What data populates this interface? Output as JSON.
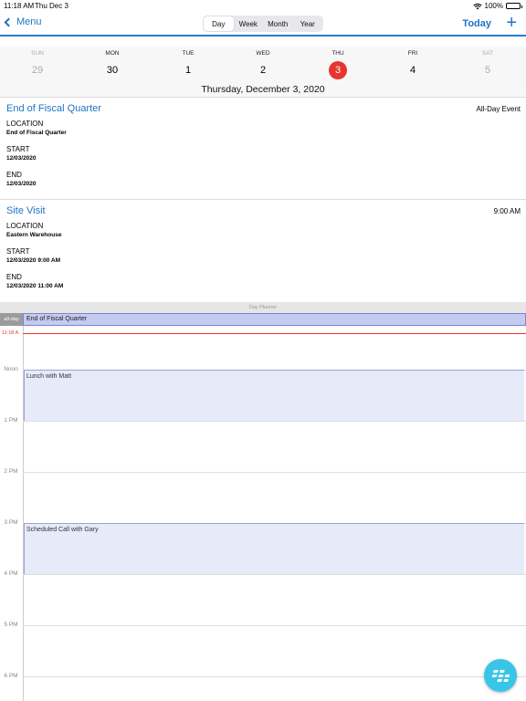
{
  "status": {
    "time": "11:18 AM",
    "date": "Thu Dec 3",
    "battery": "100%"
  },
  "nav": {
    "back_label": "Menu",
    "segments": [
      "Day",
      "Week",
      "Month",
      "Year"
    ],
    "today_label": "Today",
    "add_symbol": "+"
  },
  "week": {
    "days": [
      {
        "name": "SUN",
        "num": "29"
      },
      {
        "name": "MON",
        "num": "30"
      },
      {
        "name": "TUE",
        "num": "1"
      },
      {
        "name": "WED",
        "num": "2"
      },
      {
        "name": "THU",
        "num": "3"
      },
      {
        "name": "FRI",
        "num": "4"
      },
      {
        "name": "SAT",
        "num": "5"
      }
    ],
    "full_date": "Thursday, December 3, 2020"
  },
  "events": [
    {
      "title": "End of Fiscal Quarter",
      "right": "All-Day Event",
      "location_label": "LOCATION",
      "location": "End of Fiscal Quarter",
      "start_label": "START",
      "start": "12/03/2020",
      "end_label": "END",
      "end": "12/03/2020"
    },
    {
      "title": "Site Visit",
      "right": "9:00 AM",
      "location_label": "LOCATION",
      "location": "Eastern Warehouse",
      "start_label": "START",
      "start": "12/03/2020 9:00 AM",
      "end_label": "END",
      "end": "12/03/2020 11:00 AM"
    }
  ],
  "planner": {
    "label": "Day Planner",
    "allday_tag": "all-day",
    "allday_event": "End of Fiscal Quarter",
    "now_label": "11:18 A",
    "hours": [
      "Noon",
      "1 PM",
      "2 PM",
      "3 PM",
      "4 PM",
      "5 PM",
      "6 PM"
    ],
    "timeline_events": [
      "Lunch with Matt",
      "Scheduled Call with Gary"
    ]
  },
  "colors": {
    "accent": "#1f73c8",
    "today": "#e8352f",
    "fab": "#39c5e8"
  }
}
